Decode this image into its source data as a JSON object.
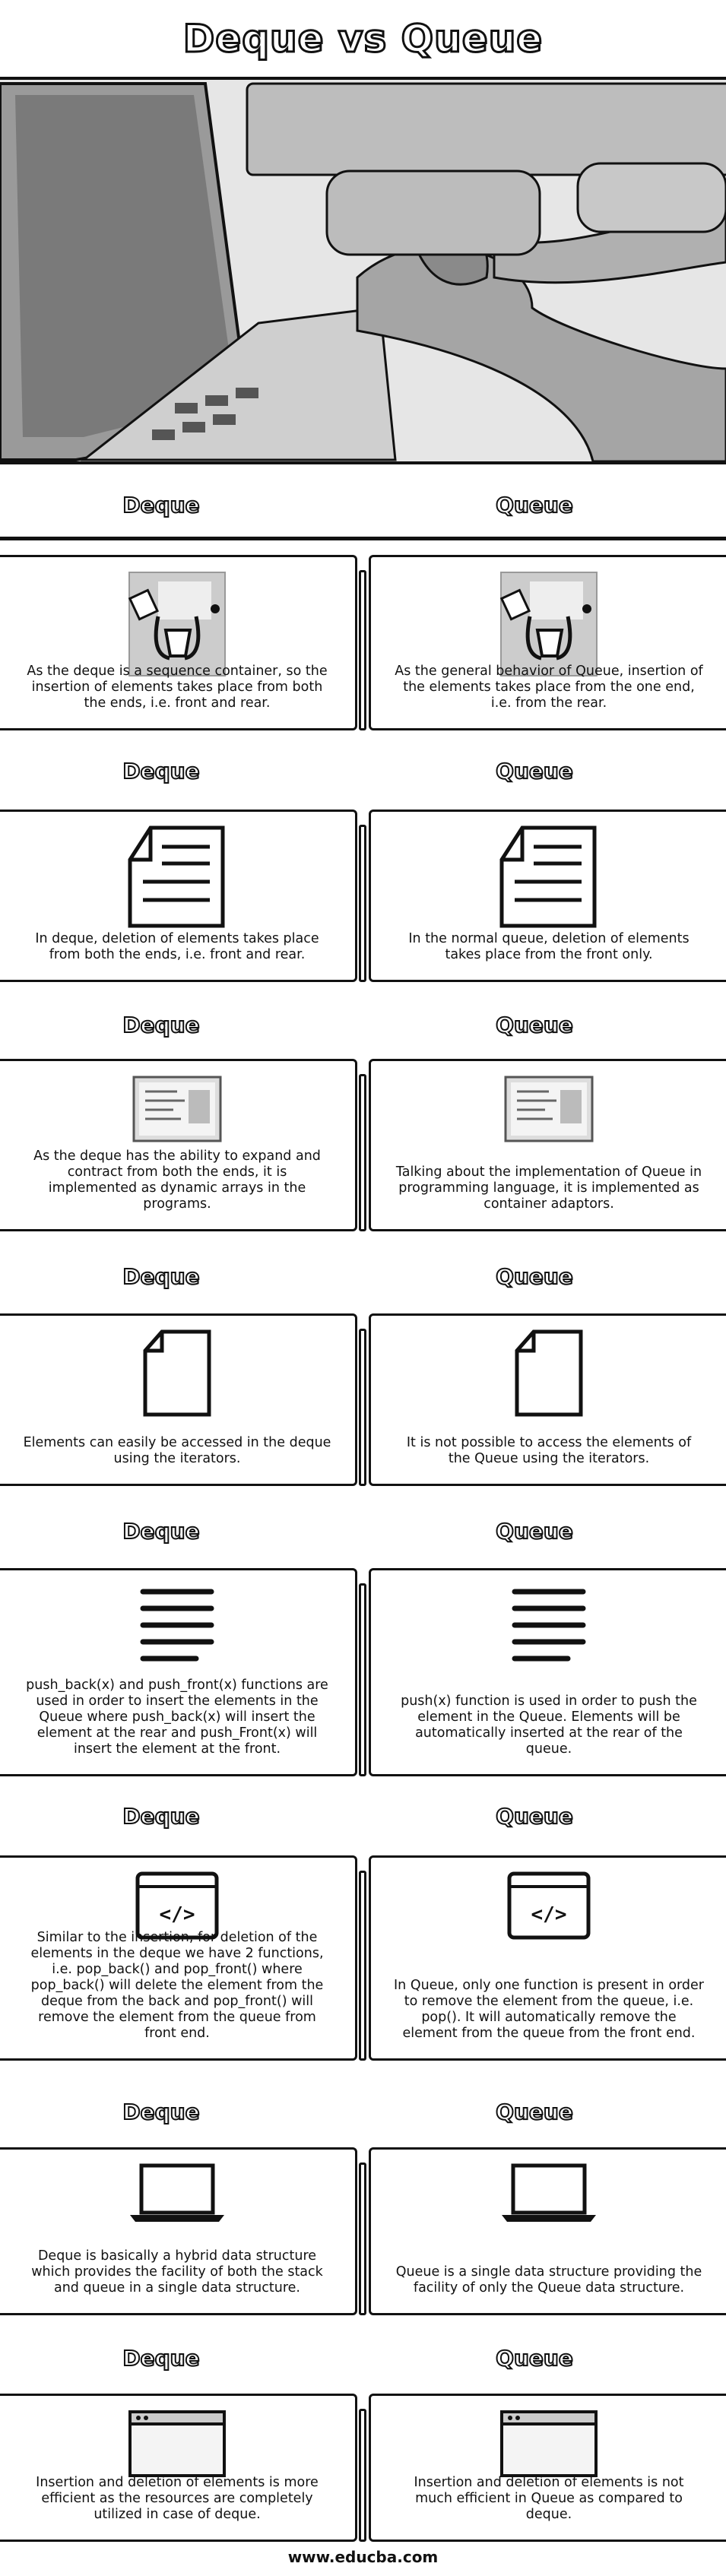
{
  "title": "Deque vs Queue",
  "footer": "www.educba.com",
  "sections": [
    {
      "left_heading": "Deque",
      "right_heading": "Queue",
      "icon": "tablet-gear-icon",
      "left_text": "As the deque is a sequence container, so the insertion of elements takes place from both the ends, i.e. front and rear.",
      "right_text": "As the general behavior of Queue, insertion of the elements takes place from the one end, i.e. from the rear."
    },
    {
      "left_heading": "Deque",
      "right_heading": "Queue",
      "icon": "document-icon",
      "left_text": "In deque, deletion of elements takes place from both the ends, i.e. front and rear.",
      "right_text": "In the normal queue, deletion of elements takes place from the front only."
    },
    {
      "left_heading": "Deque",
      "right_heading": "Queue",
      "icon": "screen-list-icon",
      "left_text": "As the deque has the ability to expand and contract from both the ends, it is implemented as dynamic arrays in the programs.",
      "right_text": "Talking about the implementation of Queue in programming language, it is implemented as container adaptors."
    },
    {
      "left_heading": "Deque",
      "right_heading": "Queue",
      "icon": "blank-page-icon",
      "left_text": "Elements can easily be accessed in the deque using the iterators.",
      "right_text": "It is not possible to access the elements of the Queue using the iterators."
    },
    {
      "left_heading": "Deque",
      "right_heading": "Queue",
      "icon": "text-lines-icon",
      "left_text": "push_back(x) and push_front(x) functions are used in order to insert the elements in the Queue where push_back(x) will insert the element at the rear and push_Front(x) will insert the element at the front.",
      "right_text": "push(x) function is used in order to push the element in the Queue. Elements will be automatically inserted at the rear of the queue."
    },
    {
      "left_heading": "Deque",
      "right_heading": "Queue",
      "icon": "code-window-icon",
      "left_text": "Similar to the insertion, for deletion of the elements in the deque we have 2 functions, i.e. pop_back() and pop_front() where pop_back() will delete the element from the deque from the back and pop_front() will remove the element from the queue from front end.",
      "right_text": "In Queue, only one function is present in order to remove the element from the queue, i.e. pop(). It will automatically remove the element from the queue from the front end."
    },
    {
      "left_heading": "Deque",
      "right_heading": "Queue",
      "icon": "laptop-icon",
      "left_text": "Deque is basically a hybrid data structure which provides the facility of both the stack and queue in a single data structure.",
      "right_text": "Queue is a single data structure providing the facility of only the Queue data structure."
    },
    {
      "left_heading": "Deque",
      "right_heading": "Queue",
      "icon": "browser-window-icon",
      "left_text": "Insertion and deletion of elements is more efficient as the resources are completely utilized in case of deque.",
      "right_text": "Insertion and deletion of elements is not much efficient in Queue as compared to deque."
    }
  ]
}
